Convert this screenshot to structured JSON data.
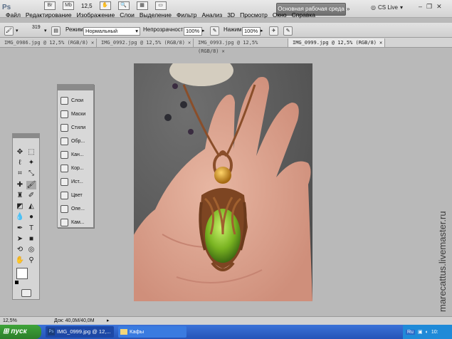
{
  "app": {
    "logo": "Ps"
  },
  "menu": [
    "Файл",
    "Редактирование",
    "Изображение",
    "Слои",
    "Выделение",
    "Фильтр",
    "Анализ",
    "3D",
    "Просмотр",
    "Окно",
    "Справка"
  ],
  "top_icons": {
    "zoom_value": "12,5"
  },
  "workspace": {
    "label": "Основная рабочая среда"
  },
  "cs_live": {
    "label": "CS Live"
  },
  "options": {
    "brush_size": "319",
    "mode_label": "Режим:",
    "mode_value": "Нормальный",
    "opacity_label": "Непрозрачность:",
    "opacity_value": "100%",
    "pressure_label": "Нажим:",
    "pressure_value": "100%"
  },
  "tabs": [
    {
      "label": "IMG_0986.jpg @ 12,5% (RGB/8)"
    },
    {
      "label": "IMG_0992.jpg @ 12,5% (RGB/8)"
    },
    {
      "label": "IMG_0993.jpg @ 12,5% (RGB/8)"
    },
    {
      "label": "IMG_0999.jpg @ 12,5% (RGB/8)"
    }
  ],
  "panels": [
    {
      "label": "Слои",
      "icon": "layers-icon"
    },
    {
      "label": "Маски",
      "icon": "masks-icon"
    },
    {
      "label": "Стили",
      "icon": "styles-icon"
    },
    {
      "label": "Обр...",
      "icon": "samples-icon"
    },
    {
      "label": "Кан...",
      "icon": "channels-icon"
    },
    {
      "label": "Кор...",
      "icon": "adjustments-icon"
    },
    {
      "label": "Ист...",
      "icon": "history-icon"
    },
    {
      "label": "Цвет",
      "icon": "color-icon"
    },
    {
      "label": "Опе...",
      "icon": "actions-icon"
    },
    {
      "label": "Кам...",
      "icon": "camera-icon"
    }
  ],
  "status": {
    "zoom": "12,5%",
    "doc": "Док: 40,0M/40,0M"
  },
  "taskbar": {
    "start": "пуск",
    "items": [
      {
        "label": "IMG_0999.jpg @ 12,..."
      },
      {
        "label": "Кафы"
      }
    ],
    "lang": "Ru",
    "time": "10:"
  },
  "watermark": "marecattus.livemaster.ru",
  "colors": {
    "taskbar": "#2454b7",
    "start": "#2d7e2a",
    "workspace": "#7c7c7c"
  }
}
